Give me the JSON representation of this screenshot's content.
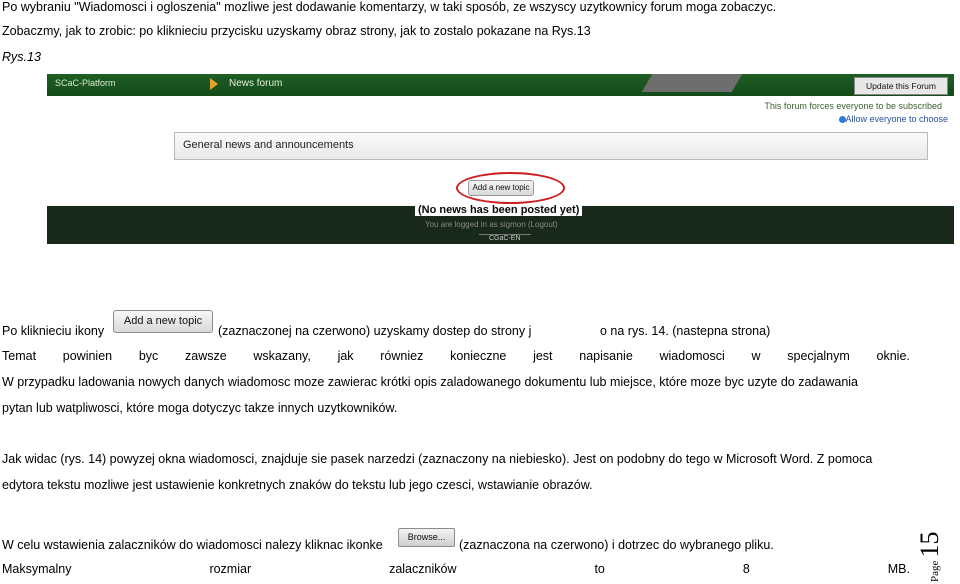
{
  "paragraphs": {
    "l1": "Po wybraniu \"Wiadomosci i ogloszenia\" mozliwe jest dodawanie komentarzy, w taki sposób, ze wszyscy uzytkownicy forum moga zobaczyc.",
    "l2": "Zobaczmy, jak to zrobic: po kliknieciu przycisku uzyskamy obraz strony, jak to zostalo pokazane na Rys.13",
    "caption": "Rys.13",
    "l3a": "Po kliknieciu ikony",
    "l3b": "(zaznaczonej na czerwono) uzyskamy dostep do strony j",
    "l3c": "o na rys. 14. (nastepna strona)",
    "l4_words": [
      "Temat",
      "powinien",
      "byc",
      "zawsze",
      "wskazany,",
      "jak",
      "równiez",
      "konieczne",
      "jest",
      "napisanie",
      "wiadomosci",
      "w",
      "specjalnym",
      "oknie."
    ],
    "l5": "W przypadku ladowania nowych danych wiadomosc moze zawierac  krótki opis zaladowanego dokumentu lub miejsce, które moze byc uzyte do zadawania",
    "l6": "pytan lub watpliwosci, które moga dotyczyc takze innych uzytkowników.",
    "l7": "Jak widac (rys. 14) powyzej okna wiadomosci, znajduje sie pasek narzedzi (zaznaczony na niebiesko). Jest on podobny do tego w Microsoft Word. Z pomoca",
    "l8": "edytora tekstu mozliwe jest ustawienie konkretnych znaków do tekstu lub jego czesci, wstawianie obrazów.",
    "l9a": "W celu wstawienia zalaczników do wiadomosci nalezy kliknac ikonke",
    "l9b": "(zaznaczona na czerwono)  i dotrzec do wybranego pliku.",
    "l10_words": [
      "Maksymalny",
      "rozmiar",
      "zalaczników",
      "to",
      "8",
      "MB."
    ]
  },
  "screenshot": {
    "brand": "SCaC-Platform",
    "crumb": "News forum",
    "update_button": "Update this Forum",
    "moderated": "This forum forces everyone to be subscribed",
    "allow": "Allow everyone to choose",
    "section_title": "General news and announcements",
    "add_topic": "Add a new topic",
    "no_news": "(No news has been posted yet)",
    "logged": "You are logged in as  sigmon  (Logout)",
    "footer": "CGaC-EN"
  },
  "inline_buttons": {
    "add_topic": "Add a new topic",
    "browse": "Browse..."
  },
  "page_marker": {
    "label": "Page",
    "number": "15"
  },
  "colors": {
    "forum_bar": "#1f5e25",
    "highlight": "#cc1f1f"
  }
}
